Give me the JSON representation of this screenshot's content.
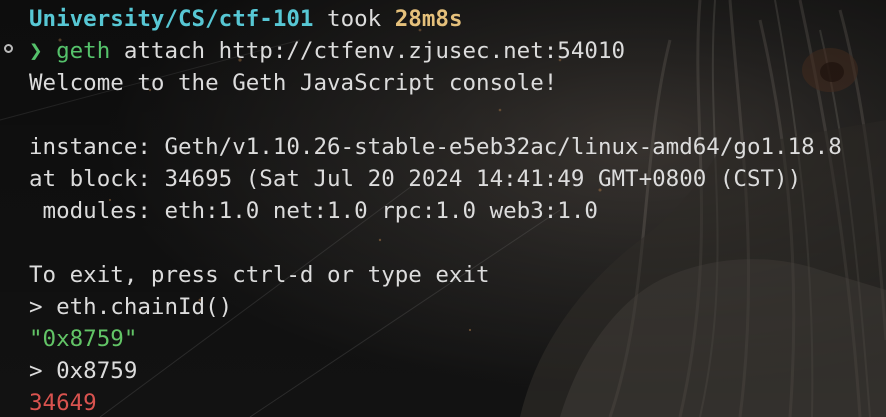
{
  "prompt": {
    "path": "University/CS/ctf-101",
    "took_word": "took",
    "duration": "28m8s",
    "symbol": "❯",
    "command": "geth",
    "args": "attach http://ctfenv.zjusec.net:54010"
  },
  "output": {
    "welcome": "Welcome to the Geth JavaScript console!",
    "instance": "instance: Geth/v1.10.26-stable-e5eb32ac/linux-amd64/go1.18.8",
    "block": "at block: 34695 (Sat Jul 20 2024 14:41:49 GMT+0800 (CST))",
    "modules": " modules: eth:1.0 net:1.0 rpc:1.0 web3:1.0",
    "exit_hint": "To exit, press ctrl-d or type exit"
  },
  "session": [
    {
      "input": "> eth.chainId()",
      "result": "\"0x8759\"",
      "result_kind": "string"
    },
    {
      "input": "> 0x8759",
      "result": "34649",
      "result_kind": "number"
    }
  ],
  "colors": {
    "path": "#57c7d4",
    "duration": "#e5c07b",
    "command": "#55c26b",
    "string": "#62c466",
    "number": "#d9534f"
  }
}
